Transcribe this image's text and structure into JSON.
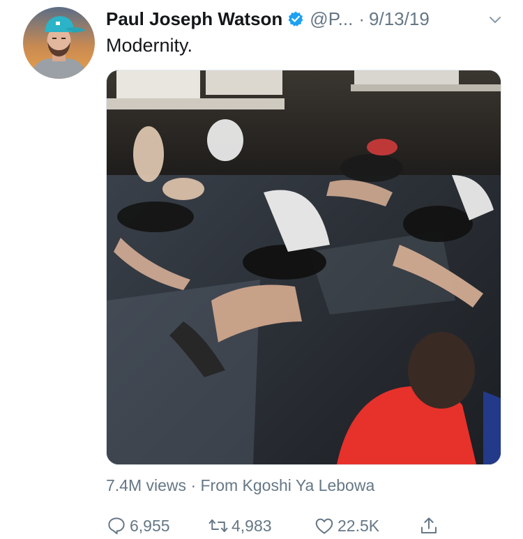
{
  "tweet": {
    "author_name": "Paul Joseph Watson",
    "handle": "@P...",
    "separator": "·",
    "date": "9/13/19",
    "text": "Modernity.",
    "meta": {
      "views": "7.4M views",
      "separator": "·",
      "source": "From Kgoshi Ya Lebowa"
    }
  },
  "actions": {
    "reply_count": "6,955",
    "retweet_count": "4,983",
    "like_count": "22.5K"
  },
  "colors": {
    "verified_blue": "#1da1f2",
    "secondary_text": "#657786",
    "primary_text": "#14171a"
  },
  "icons": {
    "verified": "verified-badge-icon",
    "chevron": "chevron-down-icon",
    "reply": "reply-icon",
    "retweet": "retweet-icon",
    "like": "heart-icon",
    "share": "share-icon"
  }
}
